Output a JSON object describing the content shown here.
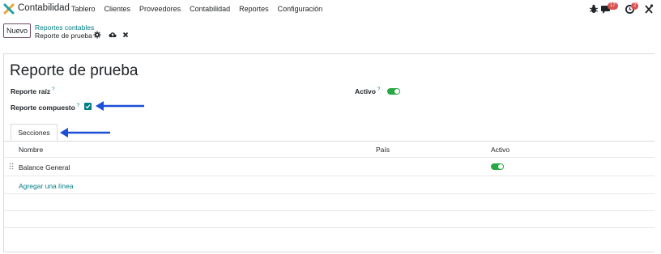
{
  "navbar": {
    "app_name": "Contabilidad",
    "menu": [
      "Tablero",
      "Clientes",
      "Proveedores",
      "Contabilidad",
      "Reportes",
      "Configuración"
    ],
    "messages_badge": "17",
    "activities_badge": "2"
  },
  "control_panel": {
    "new_button": "Nuevo",
    "breadcrumb_parent": "Reportes contables",
    "breadcrumb_current": "Reporte de prueba"
  },
  "form": {
    "title": "Reporte de prueba",
    "root_report_label": "Reporte raíz",
    "active_label": "Activo",
    "active_value": true,
    "composite_report_label": "Reporte compuesto",
    "composite_report_checked": true,
    "help_mark": "?"
  },
  "tabs": [
    "Secciones"
  ],
  "table": {
    "headers": [
      "Nombre",
      "País",
      "Activo"
    ],
    "rows": [
      {
        "nombre": "Balance General",
        "pais": "",
        "activo": true
      }
    ],
    "add_line": "Agregar una línea"
  },
  "colors": {
    "accent": "#017e84",
    "brand": "#714b67",
    "toggle_on": "#28a745",
    "annotation_arrow": "#1a4fd6",
    "badge": "#d9534f"
  }
}
